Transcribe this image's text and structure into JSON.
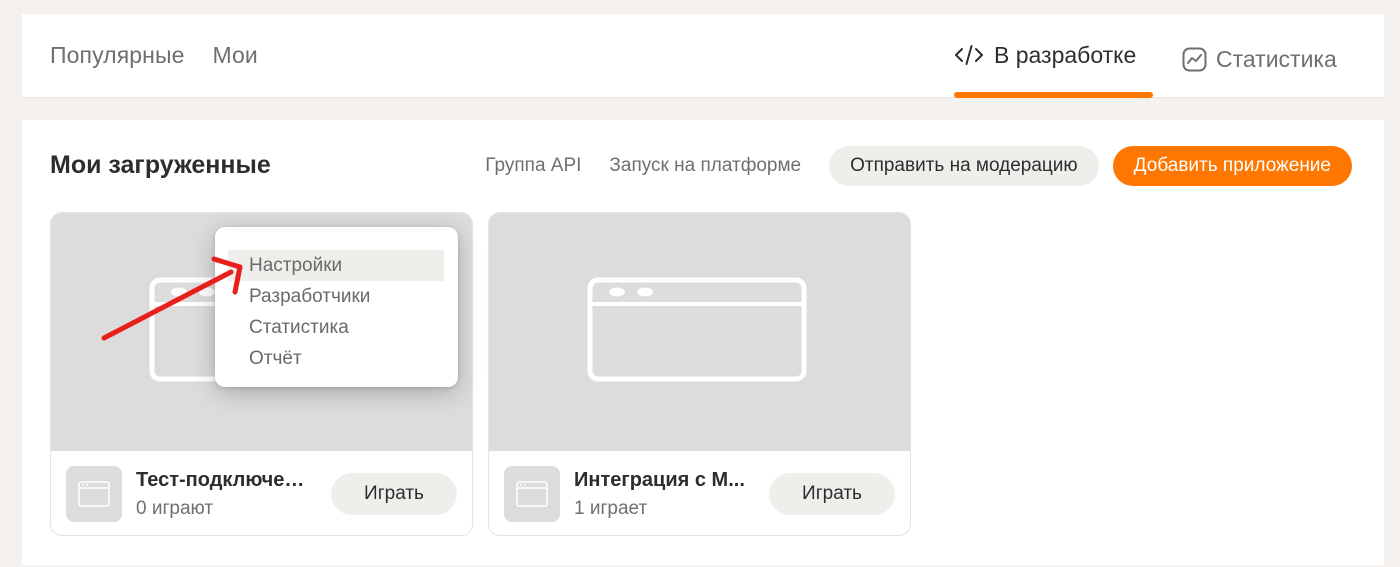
{
  "top_nav": {
    "left_links": [
      "Популярные",
      "Мои"
    ],
    "tab_dev": {
      "label": "В разработке",
      "icon": "code-icon",
      "active": true
    },
    "tab_stats": {
      "label": "Статистика",
      "icon": "chart-icon"
    },
    "accent": "#ff7700"
  },
  "section": {
    "title": "Мои загруженные",
    "link_api": "Группа API",
    "link_launch": "Запуск на платформе",
    "btn_moderation": "Отправить на модерацию",
    "btn_add": "Добавить приложение"
  },
  "cards": [
    {
      "name": "Тест-подключение",
      "players": "0 играют",
      "play_label": "Играть"
    },
    {
      "name": "Интеграция с М...",
      "players": "1 играет",
      "play_label": "Играть"
    }
  ],
  "context_menu": {
    "items": [
      "Настройки",
      "Разработчики",
      "Статистика",
      "Отчёт"
    ],
    "highlighted": "Настройки"
  },
  "annotation": {
    "color": "#e8201b"
  }
}
